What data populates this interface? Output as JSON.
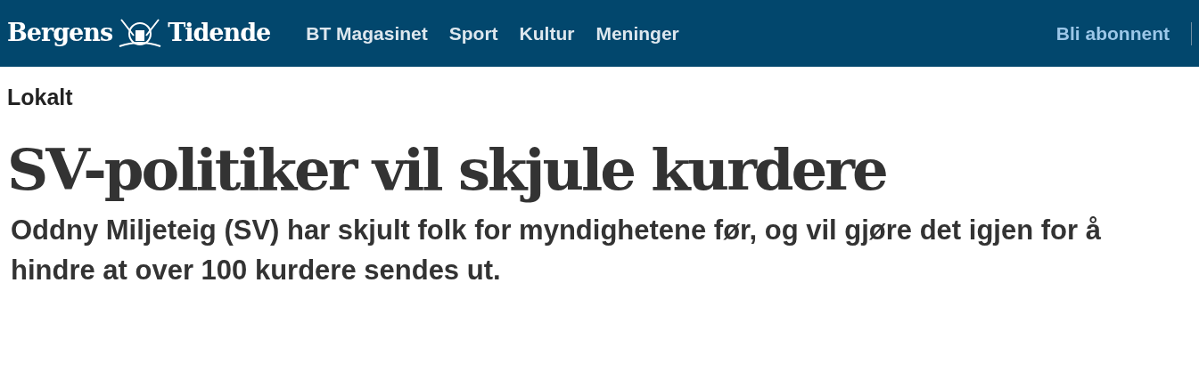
{
  "header": {
    "logo": {
      "left": "Bergens",
      "right": "Tidende"
    },
    "nav": [
      {
        "label": "BT Magasinet"
      },
      {
        "label": "Sport"
      },
      {
        "label": "Kultur"
      },
      {
        "label": "Meninger"
      }
    ],
    "subscribe": "Bli abonnent"
  },
  "article": {
    "section": "Lokalt",
    "headline": "SV-politiker vil skjule kurdere",
    "lead": "Oddny Miljeteig (SV) har skjult folk for myndighetene før, og vil gjøre det igjen for å hindre at over 100 kurdere sendes ut."
  }
}
